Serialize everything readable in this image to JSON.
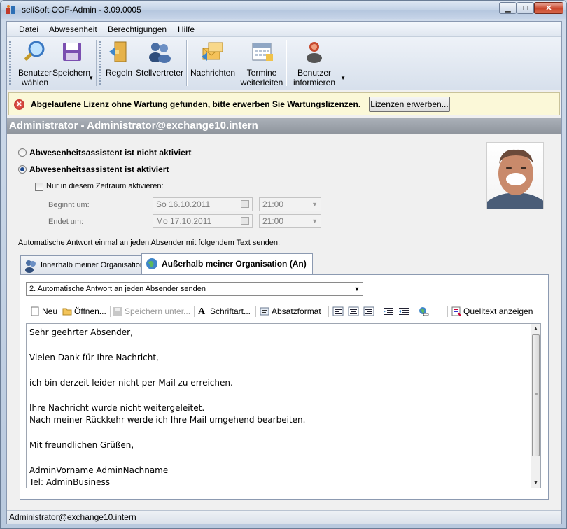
{
  "window": {
    "title": "seliSoft OOF-Admin - 3.09.0005"
  },
  "menu": [
    "Datei",
    "Abwesenheit",
    "Berechtigungen",
    "Hilfe"
  ],
  "ribbon": {
    "benutzer_waehlen": [
      "Benutzer",
      "wählen"
    ],
    "speichern": "Speichern",
    "regeln": "Regeln",
    "stellvertreter": "Stellvertreter",
    "nachrichten": "Nachrichten",
    "termine": [
      "Termine",
      "weiterleiten"
    ],
    "benutzer_informieren": [
      "Benutzer",
      "informieren"
    ]
  },
  "infobar": {
    "message": "Abgelaufene Lizenz ohne Wartung gefunden, bitte erwerben Sie Wartungslizenzen.",
    "button": "Lizenzen erwerben..."
  },
  "user": {
    "header": "Administrator - Administrator@exchange10.intern"
  },
  "status_options": {
    "inactive": "Abwesenheitsassistent ist nicht aktiviert",
    "active": "Abwesenheitsassistent ist aktiviert",
    "selected": "active"
  },
  "period": {
    "checkbox_label": "Nur in diesem Zeitraum aktivieren:",
    "begin_label": "Beginnt um:",
    "begin_date": "So 16.10.2011",
    "begin_time": "21:00",
    "end_label": "Endet um:",
    "end_date": "Mo 17.10.2011",
    "end_time": "21:00"
  },
  "auto_reply_label": "Automatische Antwort einmal an jeden Absender mit folgendem Text senden:",
  "tabs": [
    {
      "label": "Innerhalb meiner Organisation",
      "active": false
    },
    {
      "label": "Außerhalb meiner Organisation (An)",
      "active": true
    }
  ],
  "reply_mode": "2. Automatische Antwort an jeden Absender senden",
  "editor_toolbar": {
    "new": "Neu",
    "open": "Öffnen...",
    "save": "Speichern unter...",
    "font": "Schriftart...",
    "paragraph": "Absatzformat",
    "source": "Quelltext anzeigen"
  },
  "message_lines": [
    "Sehr geehrter Absender,",
    "",
    "Vielen Dank für Ihre Nachricht,",
    "",
    "ich bin derzeit leider nicht per Mail zu erreichen.",
    "",
    "Ihre Nachricht wurde nicht weitergeleitet.",
    "Nach meiner Rückkehr werde ich Ihre Mail umgehend bearbeiten.",
    "",
    "Mit freundlichen Grüßen,",
    "",
    "AdminVorname AdminNachname",
    "Tel: AdminBusiness"
  ],
  "statusbar": "Administrator@exchange10.intern",
  "icons": {
    "app": "app-icon",
    "search": "magnifier-icon",
    "save": "floppy-icon",
    "rules": "door-icon",
    "deputy": "people-icon",
    "messages": "envelopes-icon",
    "calendar": "calendar-icon",
    "inform": "person-icon"
  }
}
